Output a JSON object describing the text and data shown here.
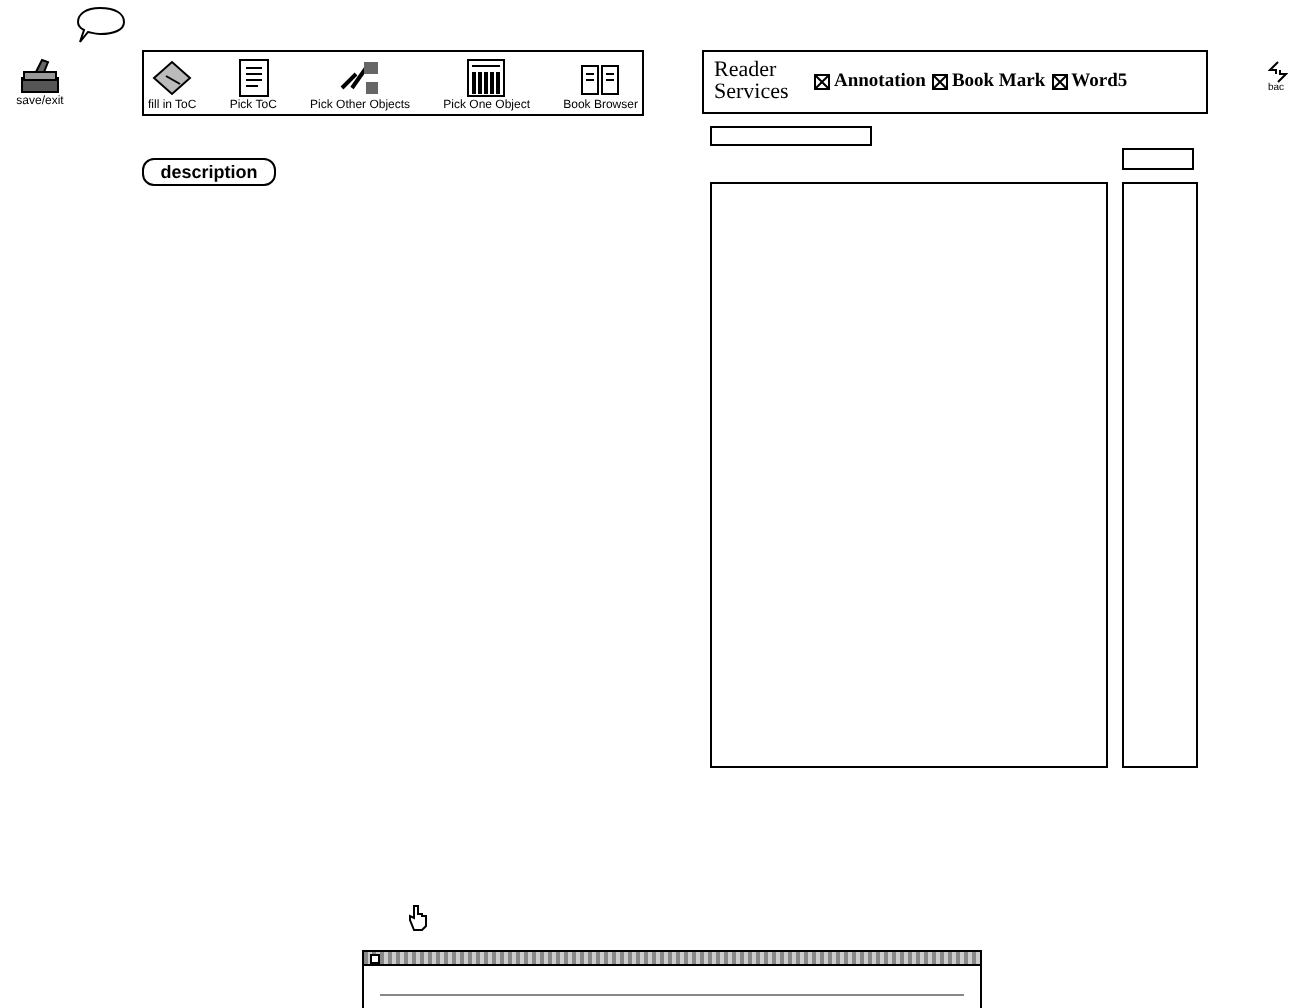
{
  "save_button": {
    "label": "save/exit"
  },
  "toolbar": [
    {
      "label": "fill in ToC"
    },
    {
      "label": "Pick ToC"
    },
    {
      "label": "Pick Other Objects"
    },
    {
      "label": "Pick One Object"
    },
    {
      "label": "Book Browser"
    }
  ],
  "description_button": {
    "label": "description"
  },
  "reader_services": {
    "title": "Reader Services",
    "options": [
      {
        "label": "Annotation",
        "checked": true
      },
      {
        "label": "Book Mark",
        "checked": true
      },
      {
        "label": "Word5",
        "checked": true
      }
    ]
  },
  "back_button": {
    "label": "bac"
  }
}
